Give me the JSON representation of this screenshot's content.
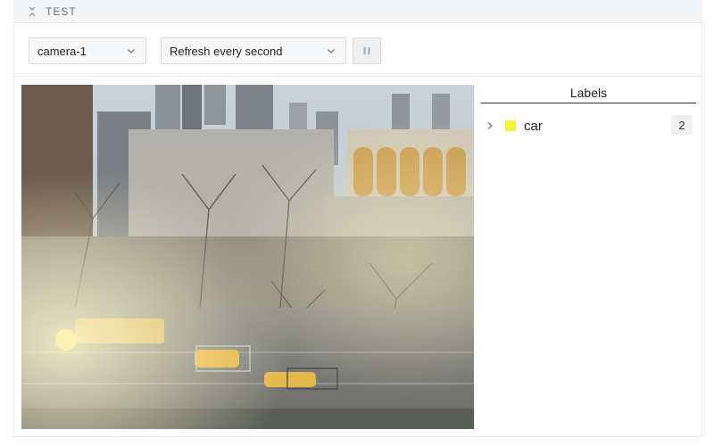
{
  "section": {
    "title": "TEST",
    "collapse_icon": "chevrons-collapse-icon"
  },
  "toolbar": {
    "camera_select": {
      "value": "camera-1"
    },
    "refresh_select": {
      "value": "Refresh every second"
    },
    "pause_icon": "pause-icon"
  },
  "camera_feed": {
    "description_icon": "camera-image",
    "detections": [
      {
        "label": "car"
      },
      {
        "label": "car"
      }
    ]
  },
  "labels_panel": {
    "title": "Labels",
    "items": [
      {
        "name": "car",
        "count": "2",
        "color": "#f7ef3c"
      }
    ]
  }
}
